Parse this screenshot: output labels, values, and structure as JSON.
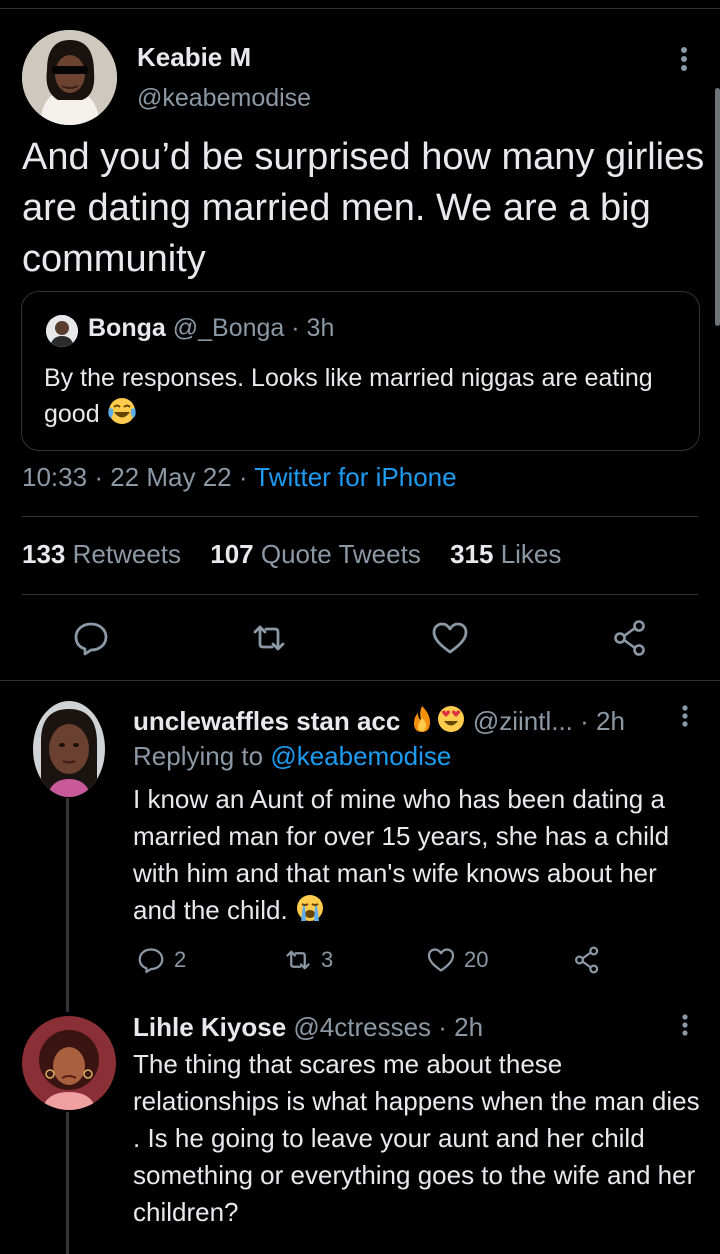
{
  "tweet": {
    "author_name": "Keabie M",
    "author_handle": "@keabemodise",
    "text": "And you’d be surprised how many girlies are dating married men. We are a big community",
    "quote": {
      "name": "Bonga",
      "handle": "@_Bonga",
      "time": "· 3h",
      "text": "By the responses. Looks like married niggas are eating good"
    },
    "time": "10:33",
    "date": "22 May 22",
    "source": "Twitter for iPhone",
    "stats": {
      "retweets_count": "133",
      "retweets_label": "Retweets",
      "quotes_count": "107",
      "quotes_label": "Quote Tweets",
      "likes_count": "315",
      "likes_label": "Likes"
    }
  },
  "replies": [
    {
      "name": "unclewaffles stan acc",
      "handle": "@ziintl...",
      "time": "· 2h",
      "replying_label": "Replying to",
      "replying_handle": "@keabemodise",
      "text": "I know an Aunt of mine who has been dating a married man for over 15 years, she has a child with him and that man's wife knows about her and the child.",
      "reply_count": "2",
      "retweet_count": "3",
      "like_count": "20"
    },
    {
      "name": "Lihle Kiyose",
      "handle": "@4ctresses",
      "time": "· 2h",
      "text": "The thing that scares me about these relationships is what happens when the man dies . Is he going to leave your aunt and her child something or everything goes to the wife and her children?"
    }
  ],
  "colors": {
    "background": "#000000",
    "text": "#e7e9ea",
    "muted": "#8b98a5",
    "link": "#1d9bf0",
    "divider": "#2f3336"
  },
  "icons": [
    "more-vertical-icon",
    "reply-icon",
    "retweet-icon",
    "like-icon",
    "share-icon",
    "joy-emoji",
    "fire-emoji",
    "heart-eyes-emoji",
    "crying-emoji"
  ]
}
